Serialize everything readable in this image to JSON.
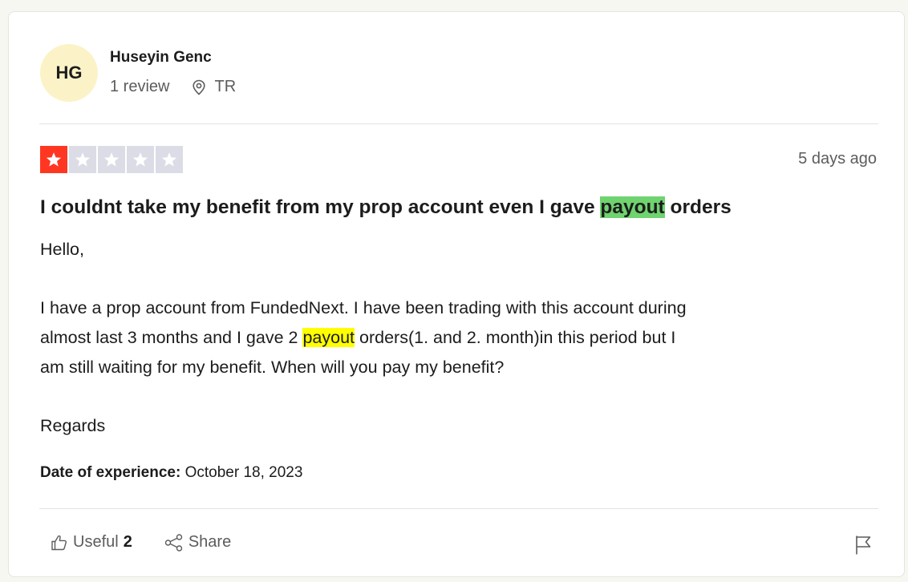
{
  "reviewer": {
    "initials": "HG",
    "name": "Huseyin Genc",
    "review_count": "1 review",
    "country": "TR"
  },
  "review": {
    "rating": 1,
    "max_rating": 5,
    "posted_ago": "5 days ago",
    "title_before": "I couldnt take my benefit from my prop account even I gave ",
    "title_highlight": "payout",
    "title_after": " orders",
    "greeting": "Hello,",
    "para_line1": "I have a prop account from FundedNext. I have been trading with this account during",
    "para_line2_before": "almost last 3 months and I gave 2 ",
    "para_line2_highlight": "payout",
    "para_line2_after": " orders(1. and 2. month)in this period but I",
    "para_line3": "am still waiting for my benefit. When will you pay my benefit?",
    "closing": "Regards",
    "experience_label": "Date of experience:",
    "experience_date": "October 18, 2023"
  },
  "actions": {
    "useful_label": "Useful",
    "useful_count": "2",
    "share_label": "Share"
  },
  "colors": {
    "star_filled": "#ff3722",
    "star_empty": "#dcdce6",
    "avatar_bg": "#fbf3c7",
    "title_highlight": "#6fd36f",
    "body_highlight": "#ffff00"
  },
  "icons": [
    "location-icon",
    "star-icon",
    "thumbs-up-icon",
    "share-icon",
    "flag-icon"
  ]
}
